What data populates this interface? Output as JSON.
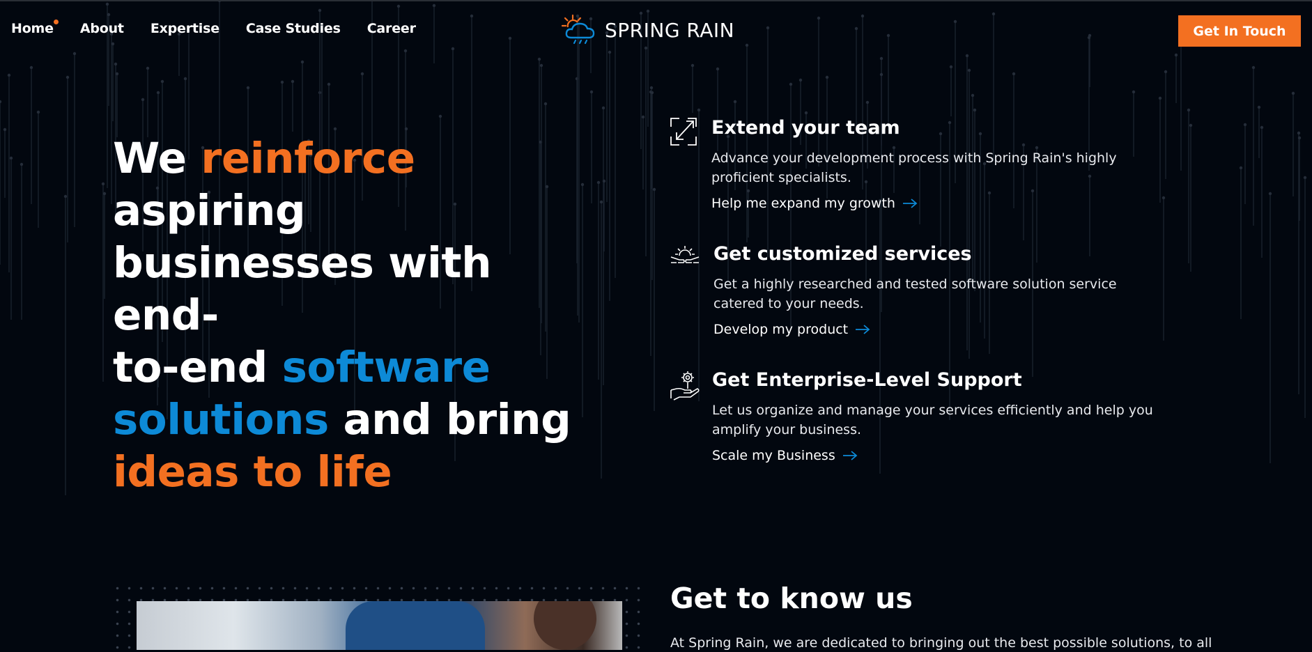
{
  "header": {
    "nav": [
      {
        "label": "Home",
        "active": true
      },
      {
        "label": "About"
      },
      {
        "label": "Expertise"
      },
      {
        "label": "Case Studies"
      },
      {
        "label": "Career"
      }
    ],
    "logo_text": "SPRING RAIN",
    "cta_label": "Get In Touch"
  },
  "hero": {
    "w1": "We",
    "w2": "reinforce",
    "w3": "aspiring",
    "w4": "businesses with end-",
    "w5": "to-end",
    "w6": "software",
    "w7": "solutions",
    "w8": "and bring",
    "w9": "ideas to life"
  },
  "features": [
    {
      "icon": "expand-arrows-icon",
      "title": "Extend your team",
      "desc_line1": "Advance your development process with Spring Rain's highly",
      "desc_line2": "proficient specialists.",
      "link": "Help me expand my growth"
    },
    {
      "icon": "gear-hands-icon",
      "title": "Get customized services",
      "desc_line1": "Get a highly researched and tested software solution service",
      "desc_line2": "catered to your needs.",
      "link": "Develop my product"
    },
    {
      "icon": "gear-hand-support-icon",
      "title": "Get Enterprise-Level Support",
      "desc_line1": "Let us organize and manage your services efficiently and help you",
      "desc_line2": "amplify your business.",
      "link": "Scale my Business"
    }
  ],
  "about": {
    "title": "Get to know us",
    "text": "At Spring Rain, we are dedicated to bringing out the best possible solutions, to all"
  },
  "colors": {
    "background": "#02070f",
    "accent_orange": "#f37021",
    "accent_blue": "#0d8ad7"
  }
}
